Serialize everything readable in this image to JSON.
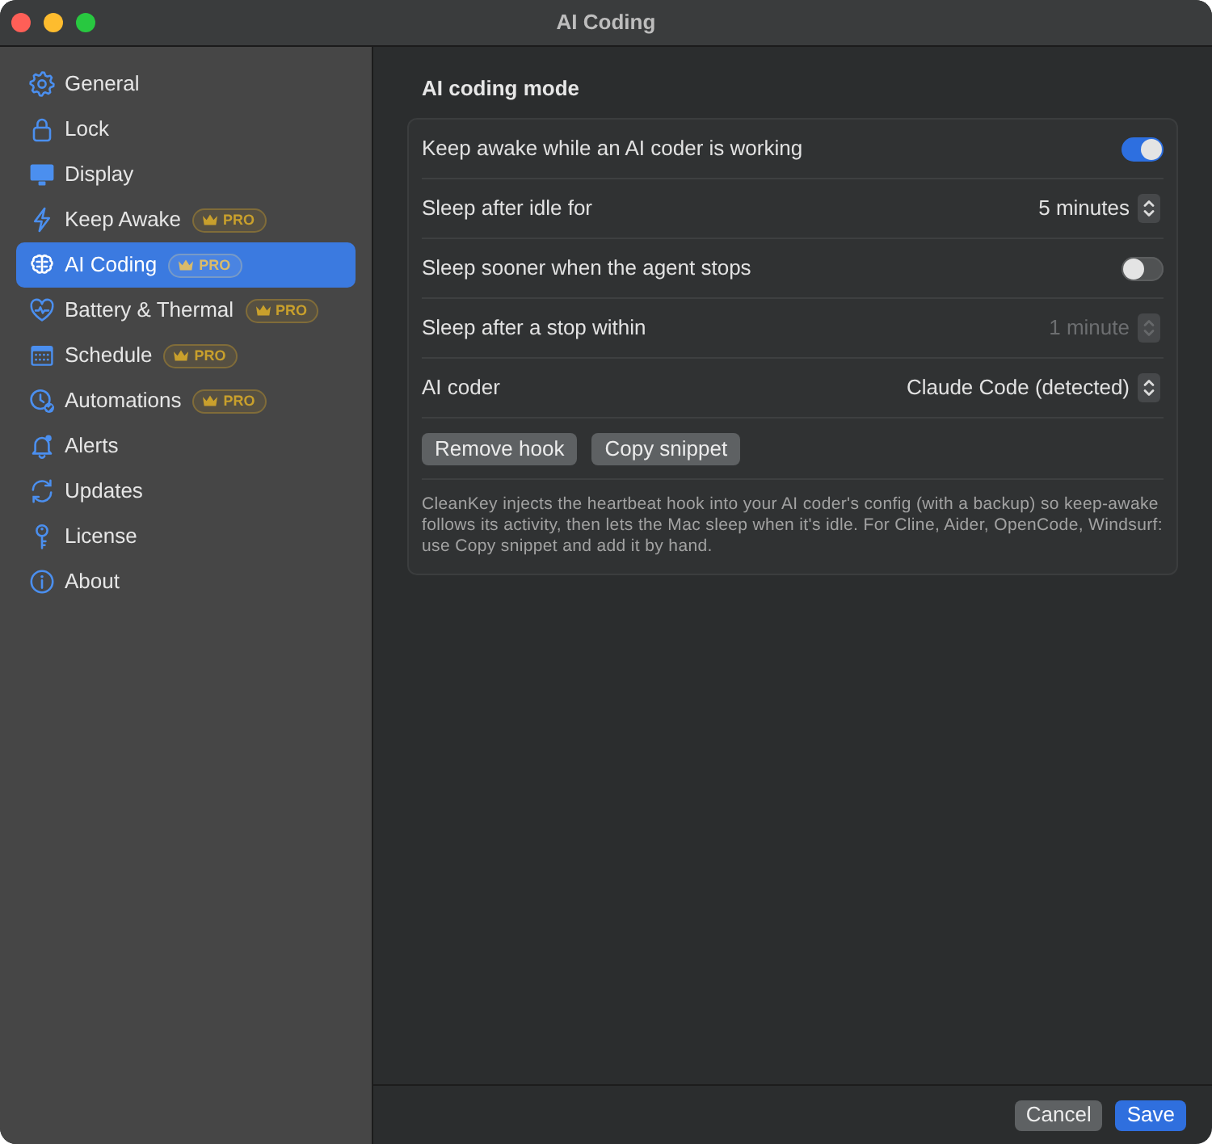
{
  "window": {
    "title": "AI Coding"
  },
  "sidebar": {
    "items": [
      {
        "label": "General",
        "selected": false
      },
      {
        "label": "Lock",
        "selected": false
      },
      {
        "label": "Display",
        "selected": false
      },
      {
        "label": "Keep Awake",
        "badge": "PRO",
        "selected": false
      },
      {
        "label": "AI Coding",
        "badge": "PRO",
        "selected": true
      },
      {
        "label": "Battery & Thermal",
        "badge": "PRO",
        "selected": false
      },
      {
        "label": "Schedule",
        "badge": "PRO",
        "selected": false
      },
      {
        "label": "Automations",
        "badge": "PRO",
        "selected": false
      },
      {
        "label": "Alerts",
        "selected": false
      },
      {
        "label": "Updates",
        "selected": false
      },
      {
        "label": "License",
        "selected": false
      },
      {
        "label": "About",
        "selected": false
      }
    ]
  },
  "section": {
    "title": "AI coding mode",
    "rows": [
      {
        "kind": "toggle",
        "label": "Keep awake while an AI coder is working",
        "on": true,
        "disabled": false
      },
      {
        "kind": "select",
        "label": "Sleep after idle for",
        "value": "5 minutes",
        "disabled": false
      },
      {
        "kind": "toggle",
        "label": "Sleep sooner when the agent stops",
        "on": false,
        "disabled": false
      },
      {
        "kind": "select",
        "label": "Sleep after a stop within",
        "value": "1 minute",
        "disabled": true
      },
      {
        "kind": "select",
        "label": "AI coder",
        "value": "Claude Code (detected)",
        "disabled": false
      }
    ],
    "buttons": [
      "Remove hook",
      "Copy snippet"
    ],
    "note": "CleanKey injects the heartbeat hook into your AI coder's config (with a backup) so keep-awake follows its activity, then lets the Mac sleep when it's idle. For Cline, Aider, OpenCode, Windsurf: use Copy snippet and add it by hand."
  },
  "footer": {
    "buttons": [
      {
        "label": "Cancel",
        "kind": "default"
      },
      {
        "label": "Save",
        "kind": "primary"
      }
    ]
  }
}
